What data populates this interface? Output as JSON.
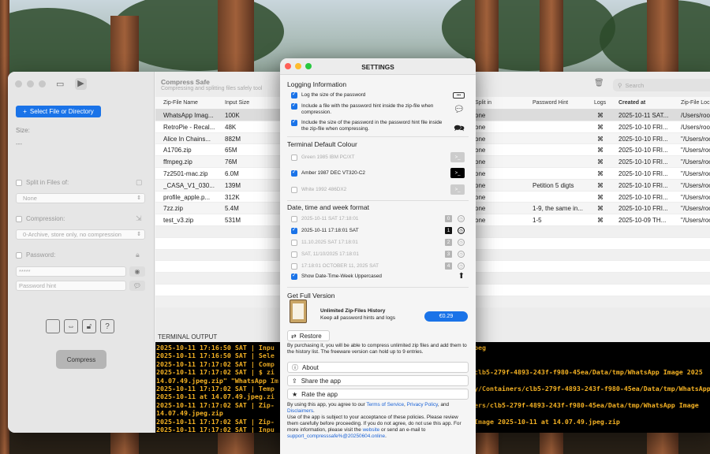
{
  "main": {
    "app_title": "Compress Safe",
    "app_subtitle": "Compressing and splitting files safely tool",
    "search_placeholder": "Search",
    "sidebar": {
      "select_button": "Select File or Directory",
      "size_label": "Size:",
      "size_value": "---",
      "split_label": "Split in Files of:",
      "split_value": "None",
      "compression_label": "Compression:",
      "compression_value": "0-Archive, store only, no compression",
      "password_label": "Password:",
      "password_value": "*****",
      "password_hint_placeholder": "Password hint",
      "compress_button": "Compress"
    },
    "table": {
      "columns": [
        "Zip-File Name",
        "Input Size",
        "Split in",
        "Password Hint",
        "Logs",
        "Created at",
        "Zip-File Loc"
      ],
      "rows": [
        {
          "name": "WhatsApp Imag...",
          "size": "100K",
          "split": "one",
          "hint": "",
          "logs": "⌘",
          "created": "2025-10-11 SAT...",
          "loc": "/Users/roo"
        },
        {
          "name": "RetroPie - Recal...",
          "size": "48K",
          "split": "one",
          "hint": "",
          "logs": "⌘",
          "created": "2025-10-10 FRI...",
          "loc": "/Users/roo"
        },
        {
          "name": "Alice In Chains...",
          "size": "882M",
          "split": "one",
          "hint": "",
          "logs": "⌘",
          "created": "2025-10-10 FRI...",
          "loc": "\"/Users/roo"
        },
        {
          "name": "A1706.zip",
          "size": "65M",
          "split": "one",
          "hint": "",
          "logs": "⌘",
          "created": "2025-10-10 FRI...",
          "loc": "\"/Users/roo"
        },
        {
          "name": "ffmpeg.zip",
          "size": "76M",
          "split": "one",
          "hint": "",
          "logs": "⌘",
          "created": "2025-10-10 FRI...",
          "loc": "\"/Users/roo"
        },
        {
          "name": "7z2501-mac.zip",
          "size": "6.0M",
          "split": "one",
          "hint": "",
          "logs": "⌘",
          "created": "2025-10-10 FRI...",
          "loc": "\"/Users/roo"
        },
        {
          "name": "_CASA_V1_030...",
          "size": "139M",
          "split": "one",
          "hint": "Petition 5 digts",
          "logs": "⌘",
          "created": "2025-10-10 FRI...",
          "loc": "\"/Users/roo"
        },
        {
          "name": "profile_apple.p...",
          "size": "312K",
          "split": "one",
          "hint": "",
          "logs": "⌘",
          "created": "2025-10-10 FRI...",
          "loc": "\"/Users/roo"
        },
        {
          "name": "7zz.zip",
          "size": "5.4M",
          "split": "one",
          "hint": "1-9, the same in...",
          "logs": "⌘",
          "created": "2025-10-10 FRI...",
          "loc": "\"/Users/roo"
        },
        {
          "name": "test_v3.zip",
          "size": "531M",
          "split": "one",
          "hint": "1-5",
          "logs": "⌘",
          "created": "2025-10-09 TH...",
          "loc": "\"/Users/roo"
        }
      ]
    },
    "terminal_label": "TERMINAL OUTPUT",
    "terminal_lines": [
      "2025-10-11 17:16:50 SAT | Inpu",
      "2025-10-11 17:16:50 SAT | Sele",
      "2025-10-11 17:17:02 SAT | Comp",
      "2025-10-11 17:17:02 SAT | $ zi",
      "14.07.49.jpeg.zip\" \"WhatsApp Im",
      "2025-10-11 17:17:02 SAT | Temp",
      "2025-10-11 at 14.07.49.jpeg.zi",
      "2025-10-11 17:17:02 SAT | Zip-",
      "14.07.49.jpeg.zip",
      "2025-10-11 17:17:02 SAT | Zip-",
      "2025-10-11 17:17:02 SAT | Inpu"
    ],
    "terminal_right_lines": [
      "peg",
      "",
      "",
      "clb5-279f-4893-243f-f980-45ea/Data/tmp/WhatsApp Image 2025",
      "",
      "y/Containers/clb5-279f-4893-243f-f980-45ea/Data/tmp/WhatsApp",
      "",
      "ers/clb5-279f-4893-243f-f980-45ea/Data/tmp/WhatsApp Image",
      "",
      "Image 2025-10-11 at 14.07.49.jpeg.zip",
      ""
    ]
  },
  "settings": {
    "title": "SETTINGS",
    "logging": {
      "heading": "Logging Information",
      "options": [
        {
          "label": "Log the size of the password",
          "checked": true
        },
        {
          "label": "Include a file with the password hint inside the zip-file when compression.",
          "checked": true
        },
        {
          "label": "Include the size of the password in the password hint file inside the zip-file when compressing.",
          "checked": true
        }
      ]
    },
    "terminal_colour": {
      "heading": "Terminal Default Colour",
      "options": [
        {
          "label": "Green 1985 IBM PC/XT",
          "checked": false
        },
        {
          "label": "Amber 1987 DEC VT320-C2",
          "checked": true
        },
        {
          "label": "White 1992 486DX2",
          "checked": false
        }
      ]
    },
    "date_format": {
      "heading": "Date, time and week format",
      "options": [
        {
          "label": "2025-10-11 SAT 17:18:01",
          "badge": "0",
          "checked": false
        },
        {
          "label": "2025-10-11 17:18:01 SAT",
          "badge": "1",
          "checked": true
        },
        {
          "label": "11.10.2025 SAT 17:18:01",
          "badge": "2",
          "checked": false
        },
        {
          "label": "SAT, 11/10/2025 17:18:01",
          "badge": "3",
          "checked": false
        },
        {
          "label": "17:18:01 OCTOBER 11, 2025 SAT",
          "badge": "4",
          "checked": false
        }
      ],
      "uppercase_label": "Show Date-Time-Week Uppercased"
    },
    "full_version": {
      "heading": "Get Full Version",
      "product_title": "Unlimited Zip-Files History",
      "product_desc": "Keep all password hints and logs",
      "price": "€0.29",
      "restore_button": "Restore",
      "purchase_note": "By purchasing it, you will be able to compress unlimited zip files and add them to the history list. The freeware version can hold up to 9 entries."
    },
    "about_button": "About",
    "share_button": "Share the app",
    "rate_button": "Rate the app",
    "legal_prefix": "By using this app, you agree to our ",
    "terms_link": "Terms of Service",
    "privacy_link": "Privacy Policy",
    "disclaimers_link": "Disclaimers",
    "legal_body": "Use of the app is subject to your acceptance of these policies. Please review them carefully before proceeding. If you do not agree, do not use this app. For more information, please visit the ",
    "website_link": "website",
    "email_prefix": " or send an e-mail to",
    "email": "support_compresssafe%@20250604.online"
  },
  "colors": {
    "accent": "#1a73e8",
    "terminal_text": "#f5b223",
    "terminal_bg": "#000000"
  }
}
